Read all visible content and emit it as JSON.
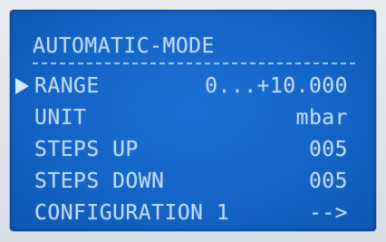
{
  "screen": {
    "title": "AUTOMATIC-MODE",
    "divider": "-------------------------",
    "selected_row": 0,
    "colors": {
      "background": "#1565c8",
      "text": "#b9d8f7"
    },
    "rows": [
      {
        "label": "RANGE",
        "value": "0...+10.000"
      },
      {
        "label": "UNIT",
        "value": "mbar"
      },
      {
        "label": "STEPS UP",
        "value": "005"
      },
      {
        "label": "STEPS DOWN",
        "value": "005"
      },
      {
        "label": "CONFIGURATION 1",
        "value": "-->"
      }
    ],
    "cursor_icon": "right-triangle-icon"
  }
}
